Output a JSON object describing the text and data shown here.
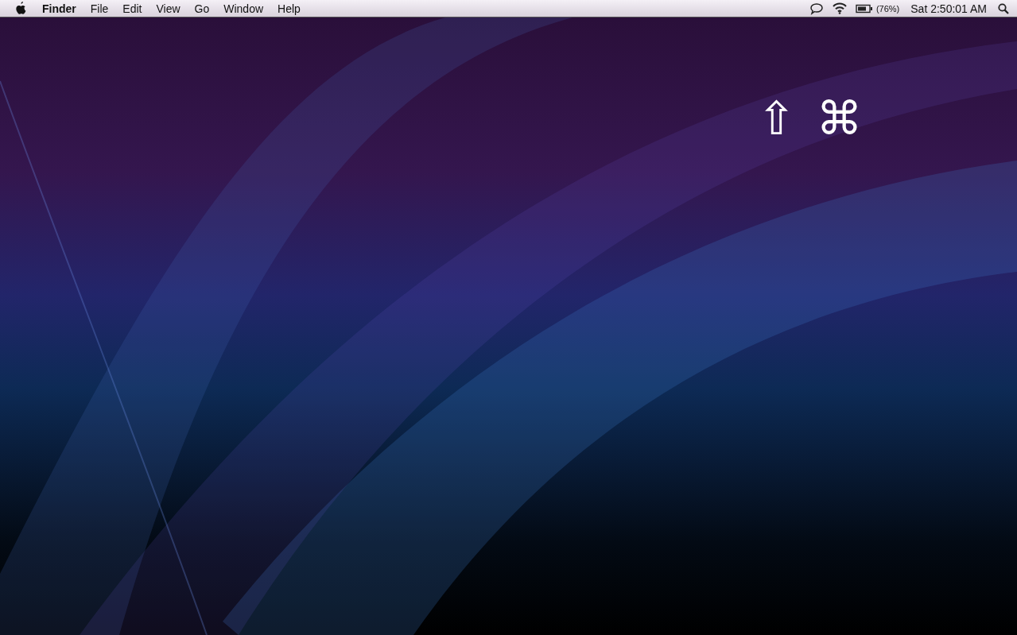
{
  "menu_bar": {
    "app_name": "Finder",
    "menus": [
      "File",
      "Edit",
      "View",
      "Go",
      "Window",
      "Help"
    ],
    "status": {
      "battery_percent": "(76%)",
      "clock": "Sat 2:50:01 AM"
    }
  },
  "keystroke_overlay": {
    "keys": [
      "⇧",
      "⌘"
    ]
  }
}
